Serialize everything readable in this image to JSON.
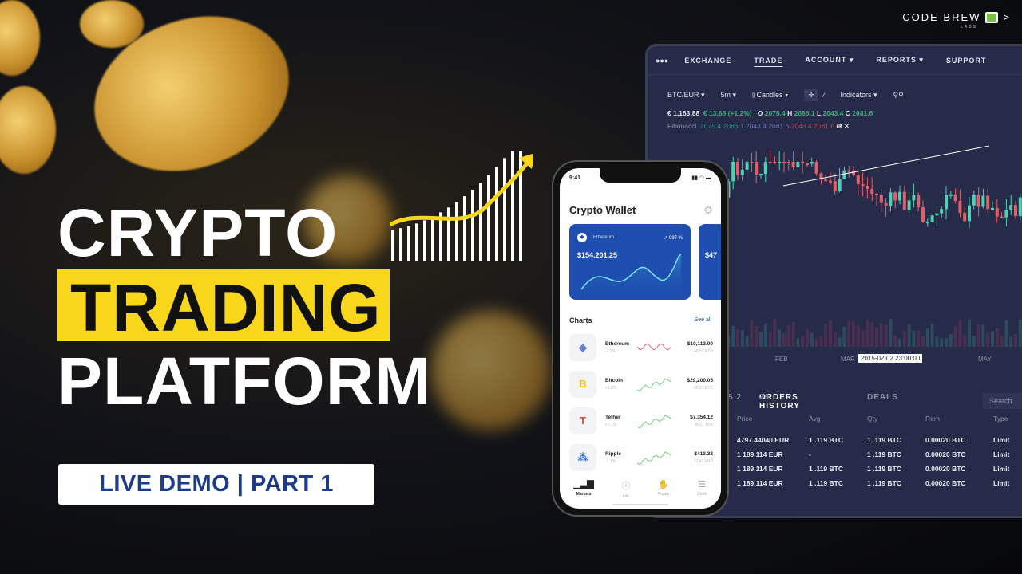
{
  "brand": {
    "name": "CODE BREW",
    "sub": "LABS"
  },
  "headline": {
    "line1": "CRYPTO",
    "line2": "TRADING",
    "line3": "PLATFORM"
  },
  "badge": "LIVE DEMO | PART 1",
  "colors": {
    "highlight": "#f7d61c",
    "badge_text": "#1e3a8a",
    "dashboard_bg": "#262b4a",
    "up": "#3bb07a",
    "down": "#c0405a",
    "card": "#1e4fb0"
  },
  "dashboard": {
    "nav": [
      "EXCHANGE",
      "TRADE",
      "ACCOUNT ▾",
      "REPORTS ▾",
      "SUPPORT"
    ],
    "active_nav": "TRADE",
    "toolbar": {
      "pair": "BTC/EUR ▾",
      "interval": "5m ▾",
      "chart_type": "Candles ▾",
      "indicators": "Indicators ▾"
    },
    "quote": {
      "price": "€ 1,163.88",
      "change": "€ 13,88 (+1.2%)",
      "o": "2075.4",
      "h": "2086.1",
      "l": "2043.4",
      "c": "2081.6"
    },
    "fibonacci": {
      "label": "Fibonacci",
      "values": [
        "2075.4",
        "2086.1",
        "2043.4",
        "2081.6"
      ],
      "red_values": [
        "2043.4",
        "2081.6"
      ]
    },
    "x_labels": [
      "FEB",
      "MAR",
      "MAY"
    ],
    "crosshair_date": "2015-02-02 23:00:00",
    "tabs": {
      "partial": "S 2",
      "orders_history": "ORDERS HISTORY",
      "orders_count": "28",
      "deals": "DEALS"
    },
    "search_placeholder": "Search",
    "table": {
      "headers": [
        "Price",
        "Avg",
        "Qty",
        "Rem",
        "Type"
      ],
      "rows": [
        [
          "4797.44040 EUR",
          "1 .119 BTC",
          "1 .119 BTC",
          "0.00020 BTC",
          "Limit"
        ],
        [
          "1 189.114 EUR",
          "-",
          "1 .119 BTC",
          "0.00020 BTC",
          "Limit"
        ],
        [
          "1 189.114 EUR",
          "1 .119 BTC",
          "1 .119 BTC",
          "0.00020 BTC",
          "Limit"
        ],
        [
          "1 189.114 EUR",
          "1 .119 BTC",
          "1 .119 BTC",
          "0.00020 BTC",
          "Limit"
        ]
      ]
    }
  },
  "phone": {
    "time": "9:41",
    "title": "Crypto Wallet",
    "card": {
      "coin": "Ethereum",
      "change": "↗ 997 %",
      "value": "$154.201,25"
    },
    "card2_value": "$47",
    "charts_label": "Charts",
    "see_all": "See all",
    "coins": [
      {
        "name": "Ethereum",
        "sub": "-2.3%",
        "value": "$10,113.00",
        "amount": "46.51 ETH",
        "icon": "ethereum-icon",
        "trend": "down"
      },
      {
        "name": "Bitcoin",
        "sub": "+1.8%",
        "value": "$29,200.05",
        "amount": "55.17 BTC",
        "icon": "bitcoin-icon",
        "trend": "up"
      },
      {
        "name": "Tether",
        "sub": "+6.1%",
        "value": "$7,354.12",
        "amount": "8021 TDX",
        "icon": "tether-icon",
        "trend": "up"
      },
      {
        "name": "Ripple",
        "sub": "-3.1%",
        "value": "$413.33",
        "amount": "12.47 XRP",
        "icon": "ripple-icon",
        "trend": "up"
      }
    ],
    "nav": [
      "Markets",
      "Info",
      "Funds",
      "Order"
    ]
  }
}
